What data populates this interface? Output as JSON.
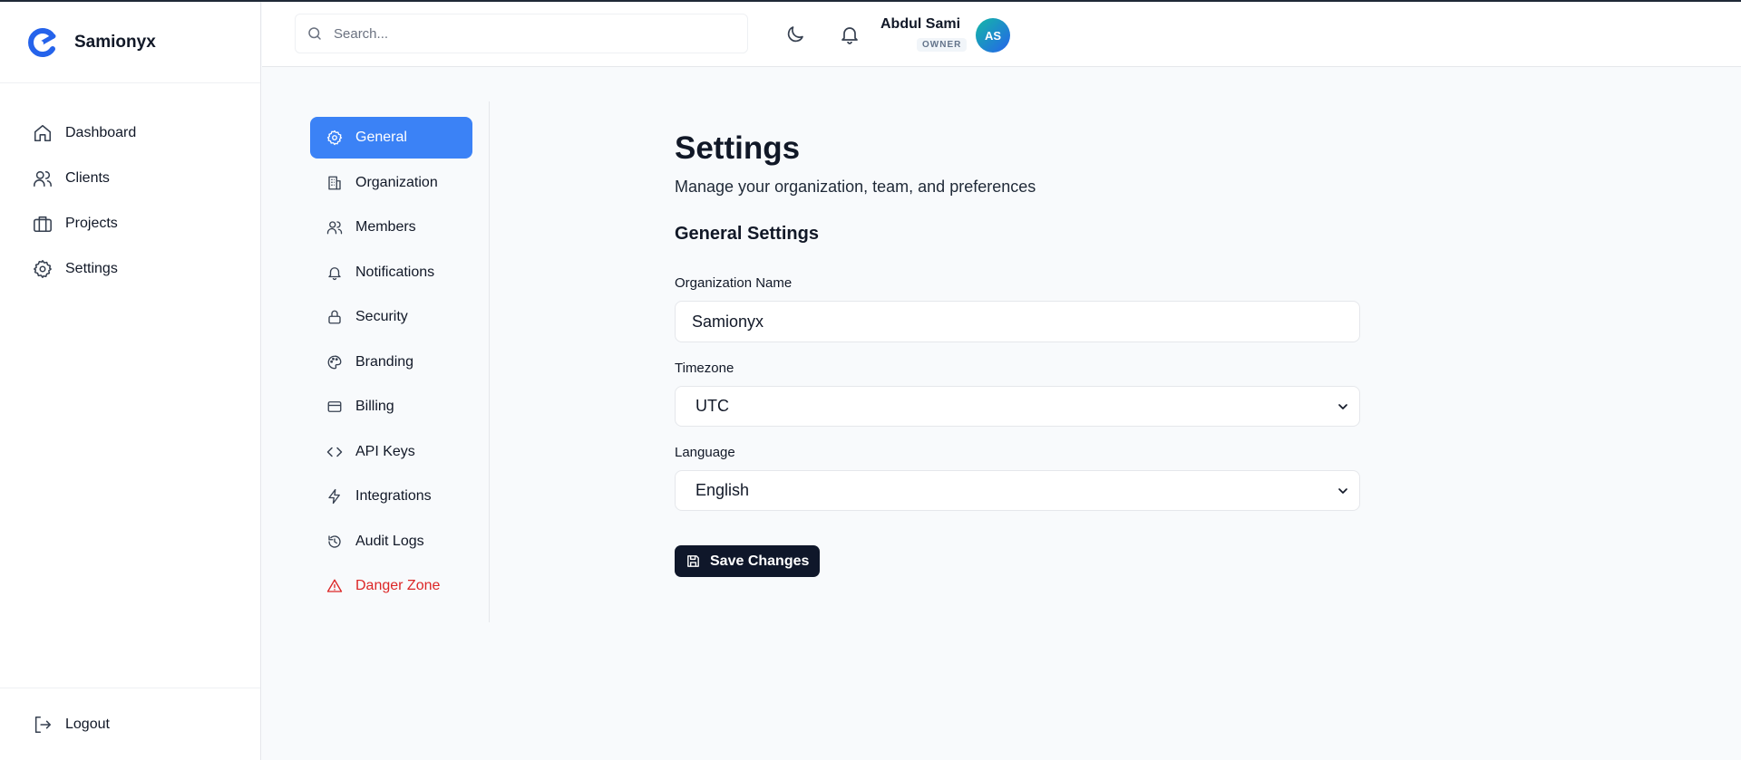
{
  "brand": {
    "name": "Samionyx",
    "logo_icon": "samionyx-logo-icon",
    "accent": "#2563eb"
  },
  "sidebar": {
    "items": [
      {
        "label": "Dashboard",
        "icon": "home-icon"
      },
      {
        "label": "Clients",
        "icon": "users-icon"
      },
      {
        "label": "Projects",
        "icon": "briefcase-icon"
      },
      {
        "label": "Settings",
        "icon": "gear-icon"
      }
    ],
    "logout": {
      "label": "Logout",
      "icon": "logout-icon"
    }
  },
  "topbar": {
    "search": {
      "placeholder": "Search...",
      "value": ""
    },
    "theme_icon": "moon-icon",
    "notifications_icon": "bell-icon",
    "user": {
      "name": "Abdul Sami",
      "role": "OWNER",
      "initials": "AS"
    }
  },
  "settings_nav": {
    "active": "General",
    "active_color": "#3b82f6",
    "danger_color": "#dc2626",
    "items": [
      {
        "label": "General",
        "icon": "gear-icon"
      },
      {
        "label": "Organization",
        "icon": "building-icon"
      },
      {
        "label": "Members",
        "icon": "users-icon"
      },
      {
        "label": "Notifications",
        "icon": "bell-icon"
      },
      {
        "label": "Security",
        "icon": "lock-icon"
      },
      {
        "label": "Branding",
        "icon": "palette-icon"
      },
      {
        "label": "Billing",
        "icon": "credit-card-icon"
      },
      {
        "label": "API Keys",
        "icon": "code-icon"
      },
      {
        "label": "Integrations",
        "icon": "lightning-icon"
      },
      {
        "label": "Audit Logs",
        "icon": "history-icon"
      },
      {
        "label": "Danger Zone",
        "icon": "warning-icon"
      }
    ]
  },
  "main": {
    "title": "Settings",
    "subtitle": "Manage your organization, team, and preferences",
    "section_title": "General Settings",
    "fields": {
      "organization_name": {
        "label": "Organization Name",
        "value": "Samionyx"
      },
      "timezone": {
        "label": "Timezone",
        "value": "UTC"
      },
      "language": {
        "label": "Language",
        "value": "English"
      }
    },
    "save_button": {
      "label": "Save Changes",
      "icon": "save-icon"
    }
  }
}
